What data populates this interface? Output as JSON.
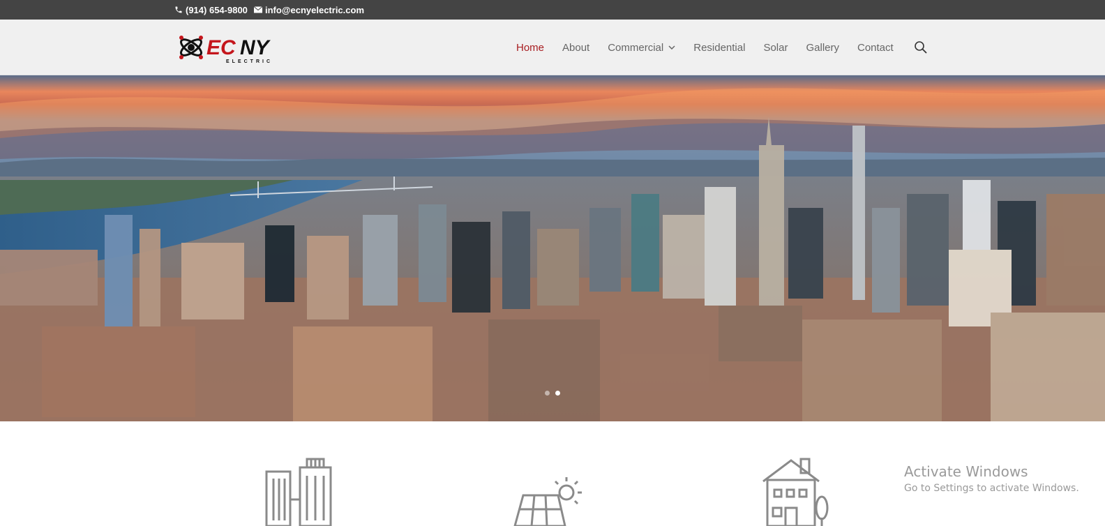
{
  "topbar": {
    "phone": "(914) 654-9800",
    "email": "info@ecnyelectric.com"
  },
  "logo": {
    "main_text": "ECNY",
    "sub_text": "ELECTRIC",
    "colors": {
      "ec": "#c4161c",
      "ny": "#111111"
    }
  },
  "nav": {
    "items": [
      {
        "label": "Home",
        "active": true
      },
      {
        "label": "About"
      },
      {
        "label": "Commercial",
        "has_dropdown": true
      },
      {
        "label": "Residential"
      },
      {
        "label": "Solar"
      },
      {
        "label": "Gallery"
      },
      {
        "label": "Contact"
      }
    ],
    "search_icon": "search-icon"
  },
  "hero": {
    "image": "new-york-skyline-panorama",
    "slides": 2,
    "active_slide": 2
  },
  "services": {
    "icons": [
      "commercial-building-icon",
      "solar-panel-icon",
      "residential-house-icon"
    ]
  },
  "watermark": {
    "title": "Activate Windows",
    "subtitle": "Go to Settings to activate Windows."
  },
  "colors": {
    "topbar_bg": "#444444",
    "header_bg": "#f0f0f0",
    "nav_text": "#666666",
    "nav_active": "#a81d21"
  }
}
